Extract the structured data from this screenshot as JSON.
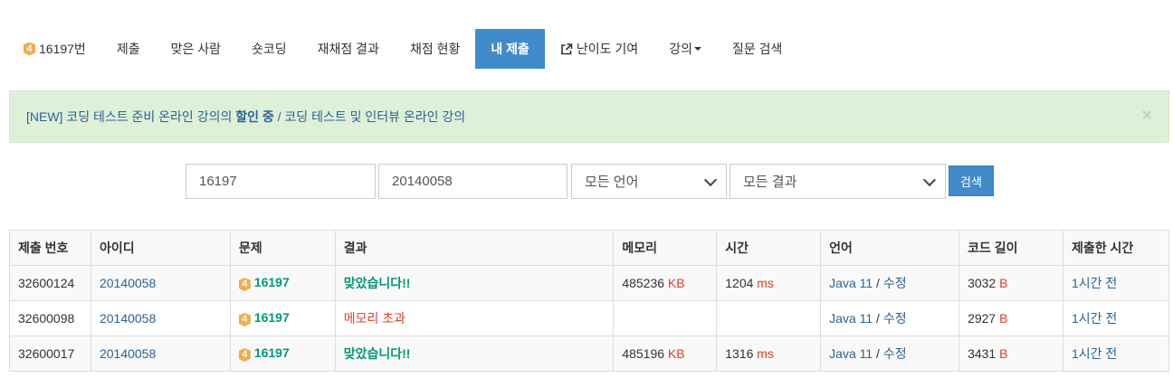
{
  "nav": {
    "problem_badge": "4",
    "problem_label": "16197번",
    "items": [
      "제출",
      "맞은 사람",
      "숏코딩",
      "재채점 결과",
      "채점 현황"
    ],
    "active": "내 제출",
    "contribute": "난이도 기여",
    "lecture": "강의",
    "question": "질문 검색"
  },
  "alert": {
    "part1": "[NEW] 코딩 테스트 준비 온라인 강의의 ",
    "part2": "할인 중",
    "part3": " / 코딩 테스트 및 인터뷰 온라인 강의",
    "close": "×"
  },
  "search": {
    "problem_id": "16197",
    "user_id": "20140058",
    "language": "모든 언어",
    "result": "모든 결과",
    "button": "검색"
  },
  "table": {
    "headers": [
      "제출 번호",
      "아이디",
      "문제",
      "결과",
      "메모리",
      "시간",
      "언어",
      "코드 길이",
      "제출한 시간"
    ],
    "rows": [
      {
        "id": "32600124",
        "user": "20140058",
        "badge": "4",
        "problem": "16197",
        "result": "맞았습니다!!",
        "memory": "485236",
        "memory_unit": "KB",
        "time": "1204",
        "time_unit": "ms",
        "lang": "Java 11",
        "edit": "수정",
        "code": "3032",
        "code_unit": "B",
        "submitted": "1시간 전"
      },
      {
        "id": "32600098",
        "user": "20140058",
        "badge": "4",
        "problem": "16197",
        "result": "메모리 초과",
        "memory": "",
        "memory_unit": "",
        "time": "",
        "time_unit": "",
        "lang": "Java 11",
        "edit": "수정",
        "code": "2927",
        "code_unit": "B",
        "submitted": "1시간 전"
      },
      {
        "id": "32600017",
        "user": "20140058",
        "badge": "4",
        "problem": "16197",
        "result": "맞았습니다!!",
        "memory": "485196",
        "memory_unit": "KB",
        "time": "1316",
        "time_unit": "ms",
        "lang": "Java 11",
        "edit": "수정",
        "code": "3431",
        "code_unit": "B",
        "submitted": "1시간 전"
      }
    ]
  },
  "colors": {
    "accent": "#428bca",
    "success": "#009874",
    "error": "#dd4124",
    "alert_bg": "#dff0d8"
  }
}
